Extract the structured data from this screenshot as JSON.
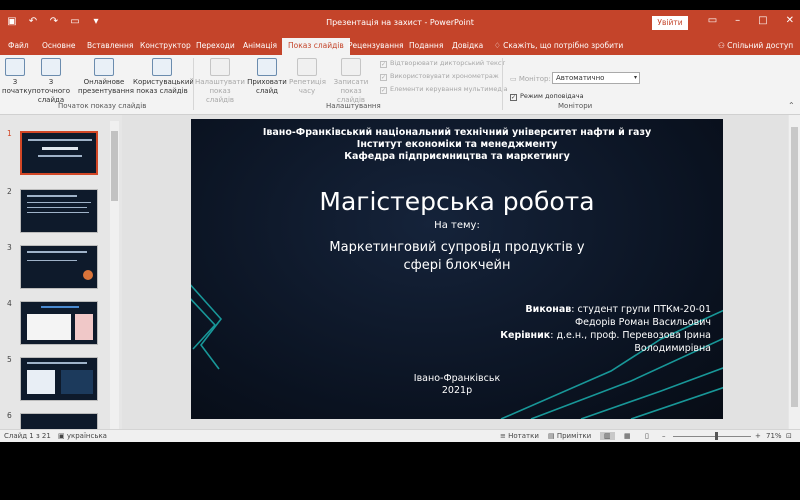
{
  "window": {
    "title": "Презентація на захист  -  PowerPoint",
    "signin_label": "Увійти",
    "accent_color": "#c4442a"
  },
  "tabs": [
    {
      "label": "Файл"
    },
    {
      "label": "Основне"
    },
    {
      "label": "Вставлення"
    },
    {
      "label": "Конструктор"
    },
    {
      "label": "Переходи"
    },
    {
      "label": "Анімація"
    },
    {
      "label": "Показ слайдів",
      "active": true
    },
    {
      "label": "Рецензування"
    },
    {
      "label": "Подання"
    },
    {
      "label": "Довідка"
    }
  ],
  "tellme": "Скажіть, що потрібно зробити",
  "share": "Спільний доступ",
  "ribbon": {
    "from_start": "З початку",
    "from_current": "З поточного слайда",
    "online": "Онлайнове презентування",
    "custom": "Користувацький показ слайдів",
    "setup": "Налаштувати показ слайдів",
    "hide": "Приховати слайд",
    "rehearse": "Репетиція часу",
    "record": "Записати показ слайдів",
    "chk_narration": "Відтворювати дикторський текст",
    "chk_timings": "Використовувати хронометраж",
    "chk_media": "Елементи керування мультимедіа",
    "monitor_label": "Монітор:",
    "monitor_value": "Автоматично",
    "presenter_view": "Режим доповідача",
    "group_start": "Початок показу слайдів",
    "group_setup": "Налаштування",
    "group_monitors": "Монітори"
  },
  "thumbnails": [
    {
      "num": "1",
      "selected": true
    },
    {
      "num": "2"
    },
    {
      "num": "3"
    },
    {
      "num": "4"
    },
    {
      "num": "5"
    },
    {
      "num": "6"
    }
  ],
  "slide": {
    "header1": "Івано-Франківський національний технічний університет нафти й газу",
    "header2": "Інститут економіки та менеджменту",
    "header3": "Кафедра підприємництва та маркетингу",
    "title": "Магістерська робота",
    "subtitle": "На тему:",
    "topic1": "Маркетинговий супровід продуктів у",
    "topic2": "сфері блокчейн",
    "author_label": "Виконав",
    "author_line1": ": студент групи ПТКм-20-01",
    "author_line2": "Федорів Роман Васильович",
    "supervisor_label": "Керівник",
    "supervisor_line1": ": д.е.н., проф. Перевозова Ірина",
    "supervisor_line2": "Володимирівна",
    "city": "Івано-Франківськ",
    "year": "2021р"
  },
  "statusbar": {
    "slide_counter": "Слайд 1 з 21",
    "language": "українська",
    "notes": "Нотатки",
    "comments": "Примітки",
    "zoom": "71%"
  }
}
